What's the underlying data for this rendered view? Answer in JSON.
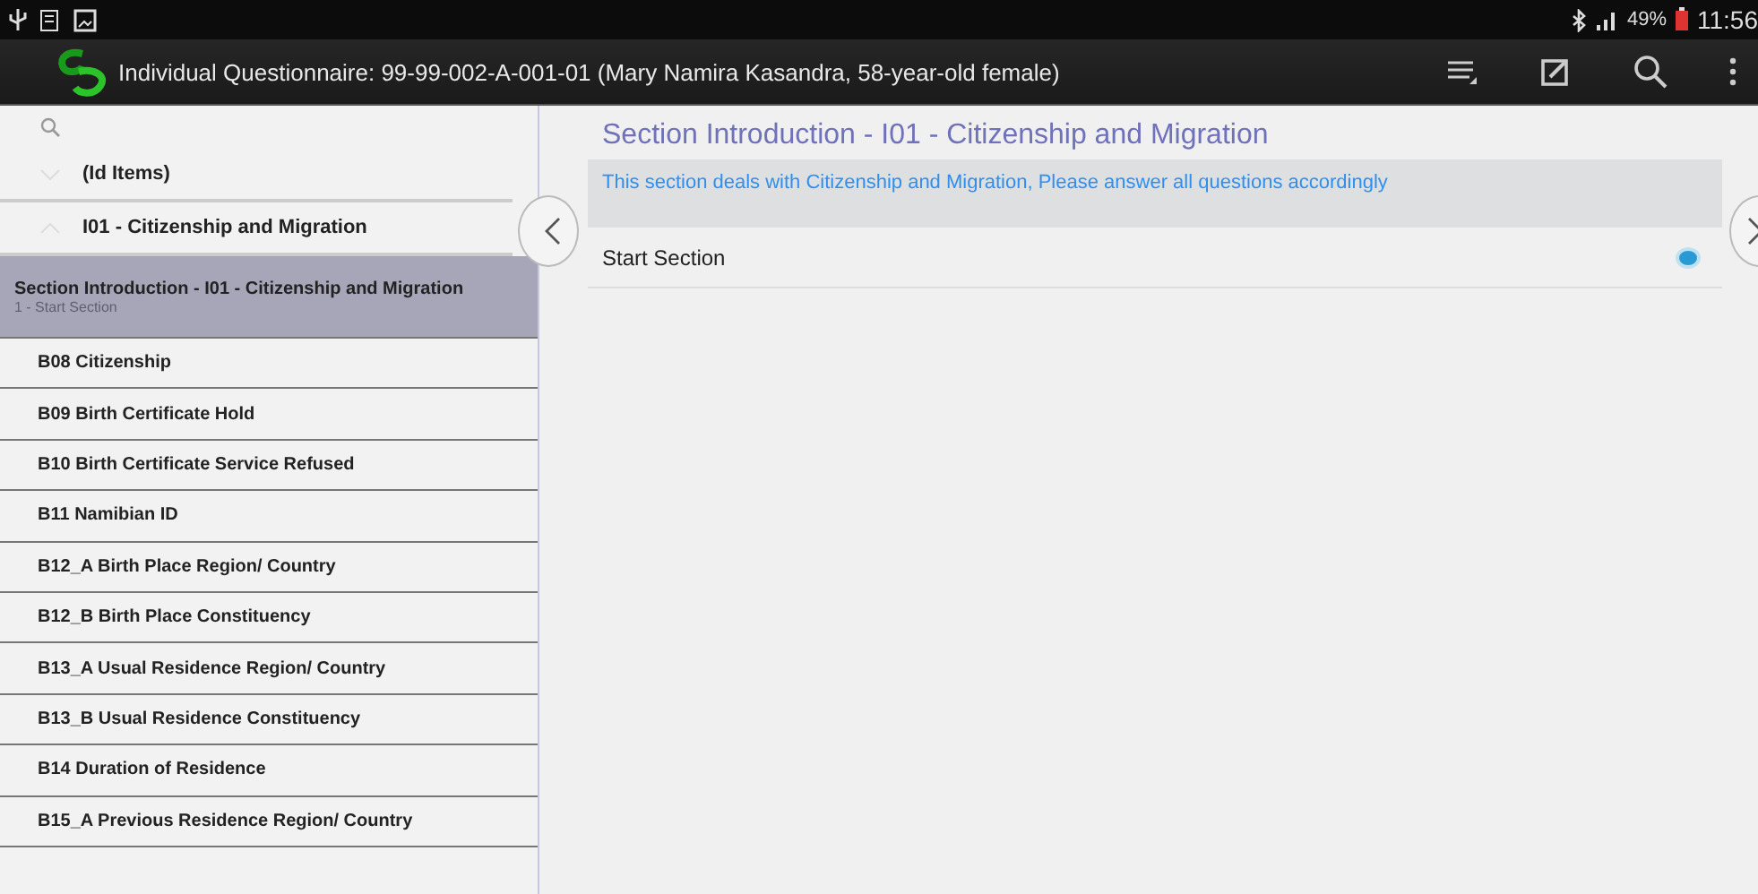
{
  "status_bar": {
    "battery": "49%",
    "time": "11:56"
  },
  "window": {
    "title": "Individual Questionnaire: 99-99-002-A-001-01 (Mary Namira Kasandra, 58-year-old female)"
  },
  "sidebar": {
    "groups": [
      {
        "label": "(Id Items)",
        "expanded": false
      },
      {
        "label": "I01 - Citizenship and Migration",
        "expanded": true
      }
    ],
    "items": [
      {
        "label": "Section Introduction - I01 - Citizenship and Migration",
        "subtitle": "1 - Start Section",
        "selected": true
      },
      {
        "label": "B08 Citizenship",
        "selected": false
      },
      {
        "label": "B09 Birth Certificate Hold",
        "selected": false
      },
      {
        "label": "B10 Birth Certificate Service Refused",
        "selected": false
      },
      {
        "label": "B11 Namibian ID",
        "selected": false
      },
      {
        "label": "B12_A Birth Place Region/ Country",
        "selected": false
      },
      {
        "label": "B12_B Birth Place Constituency",
        "selected": false
      },
      {
        "label": "B13_A Usual Residence Region/ Country",
        "selected": false
      },
      {
        "label": "B13_B Usual Residence Constituency",
        "selected": false
      },
      {
        "label": "B14 Duration of Residence",
        "selected": false
      },
      {
        "label": "B15_A Previous Residence Region/ Country",
        "selected": false
      }
    ]
  },
  "main": {
    "title": "Section Introduction - I01 - Citizenship and Migration",
    "note": "This section deals with Citizenship and Migration, Please answer all questions accordingly",
    "options": [
      {
        "label": "Start Section",
        "selected": true
      }
    ]
  }
}
